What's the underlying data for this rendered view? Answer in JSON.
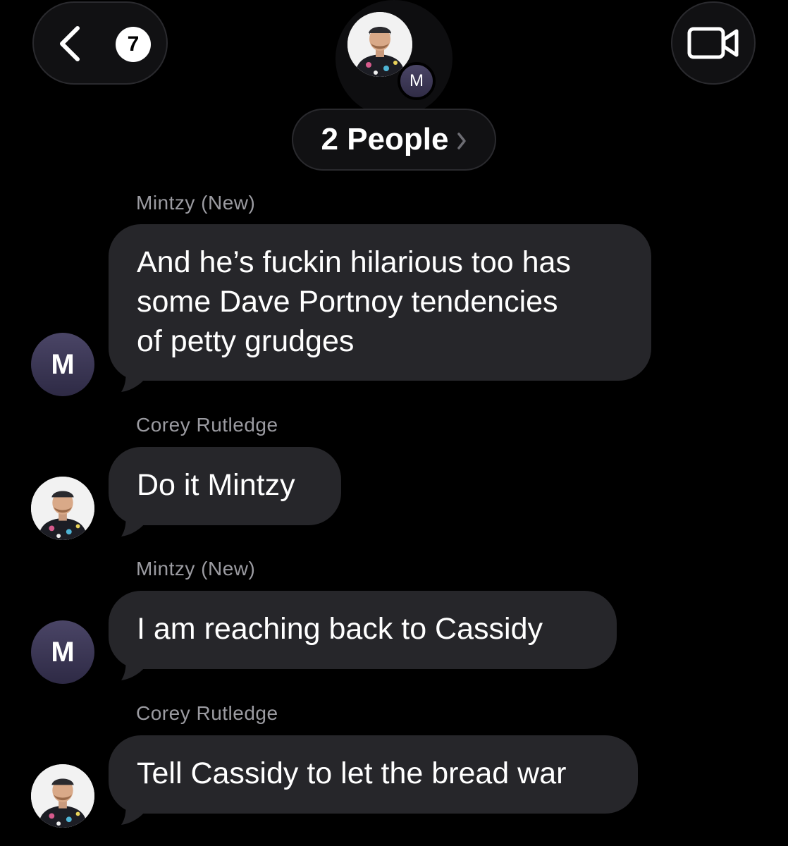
{
  "header": {
    "back_badge": "7",
    "group_avatar_letter": "M",
    "people_label": "2 People"
  },
  "icons": {
    "back": "chevron-left-icon",
    "people_disclosure": "chevron-right-icon",
    "video": "video-camera-icon"
  },
  "colors": {
    "background": "#000000",
    "bubble": "#26262a",
    "sender_text": "#9b9ba1",
    "avatar_m": "#3b3754"
  },
  "messages": [
    {
      "sender": "Mintzy (New)",
      "avatar": "M",
      "lines": [
        "And he’s fuckin hilarious too has",
        "some Dave Portnoy tendencies",
        "of petty grudges"
      ]
    },
    {
      "sender": "Corey Rutledge",
      "avatar": "photo",
      "lines": [
        "Do it Mintzy"
      ]
    },
    {
      "sender": "Mintzy (New)",
      "avatar": "M",
      "lines": [
        "I am reaching back to Cassidy"
      ]
    },
    {
      "sender": "Corey Rutledge",
      "avatar": "photo",
      "lines": [
        "Tell Cassidy to let the bread war"
      ]
    }
  ]
}
